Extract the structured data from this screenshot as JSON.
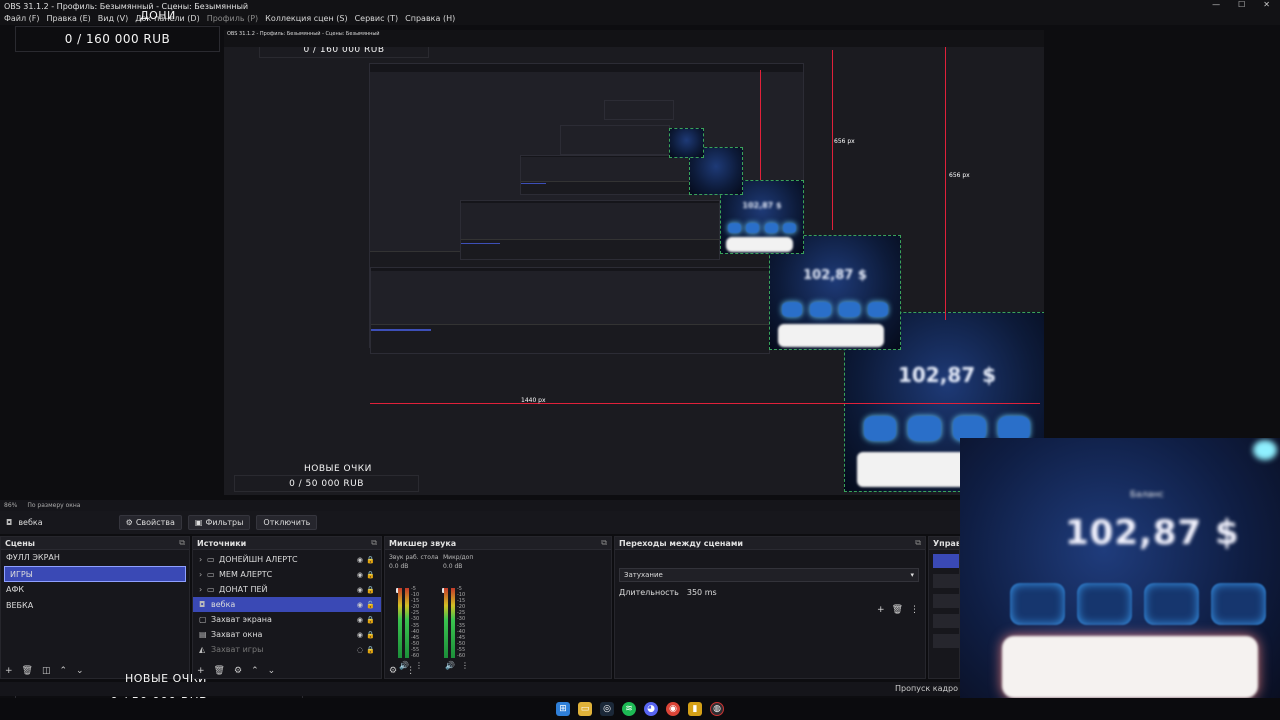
{
  "window": {
    "title": "OBS 31.1.2 - Профиль: Безымянный - Сцены: Безымянный",
    "controls": [
      "—",
      "☐",
      "✕"
    ]
  },
  "menu": [
    "Файл (F)",
    "Правка (E)",
    "Вид (V)",
    "Док-панели (D)",
    "Профиль (P)",
    "Коллекция сцен (S)",
    "Сервис (T)",
    "Справка (H)"
  ],
  "overlays": {
    "donations_title": "ДОНИ",
    "donations_amount": "0 / 160 000 RUB",
    "glasses_title": "НОВЫЕ ОЧКИ",
    "glasses_amount": "0 / 50 000 RUB"
  },
  "measurements": {
    "px_1440": "1440 px",
    "px_656_a": "656 px",
    "px_656_b": "656 px"
  },
  "zoombar": {
    "zoom": "86%",
    "fit": "По размеру окна"
  },
  "source_toolbar": {
    "current_source": "вебка",
    "properties": "Свойства",
    "filters": "Фильтры",
    "disable": "Отключить"
  },
  "scenes": {
    "title": "Сцены",
    "items": [
      {
        "label": "ФУЛЛ ЭКРАН",
        "selected": false
      },
      {
        "label": "ИГРЫ",
        "selected": true
      },
      {
        "label": "АФК",
        "selected": false
      },
      {
        "label": "ВЕБКА",
        "selected": false
      }
    ]
  },
  "sources": {
    "title": "Источники",
    "items": [
      {
        "label": "ДОНЕЙШН АЛЕРТС",
        "icon": "folder-icon",
        "group": true
      },
      {
        "label": "МЕМ АЛЕРТС",
        "icon": "folder-icon",
        "group": true
      },
      {
        "label": "ДОНАТ ПЕЙ",
        "icon": "folder-icon",
        "group": true
      },
      {
        "label": "вебка",
        "icon": "camera-icon",
        "group": false
      },
      {
        "label": "Захват экрана",
        "icon": "monitor-icon",
        "group": false
      },
      {
        "label": "Захват окна",
        "icon": "window-icon",
        "group": false
      },
      {
        "label": "Захват игры",
        "icon": "gamepad-icon",
        "group": false
      }
    ]
  },
  "mixer": {
    "title": "Микшер звука",
    "channels": [
      {
        "name": "Звук раб. стола",
        "db": "0.0 dB"
      },
      {
        "name": "Микр/доп",
        "db": "0.0 dB"
      }
    ],
    "scale": [
      "-5",
      "-10",
      "-15",
      "-20",
      "-25",
      "-30",
      "-35",
      "-40",
      "-45",
      "-50",
      "-55",
      "-60"
    ]
  },
  "transitions": {
    "title": "Переходы между сценами",
    "selected": "Затухание",
    "duration_label": "Длительность",
    "duration_value": "350 ms"
  },
  "controls": {
    "title": "Управл"
  },
  "status": {
    "text": "Пропуск кадро"
  },
  "colors": {
    "accent": "#3a49b5",
    "measure_red": "#e0213a",
    "meter_green": "#3bc44f"
  }
}
